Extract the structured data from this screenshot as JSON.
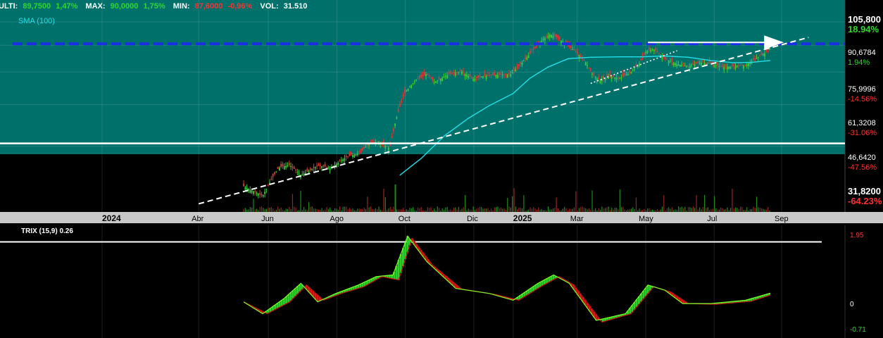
{
  "header": {
    "ulti_label": "ULTI:",
    "ulti_value": "89,7500",
    "ulti_pct": "1,47%",
    "max_label": "MAX:",
    "max_value": "90,0000",
    "max_pct": "1,75%",
    "min_label": "MIN:",
    "min_value": "87,6000",
    "min_pct": "-0,96%",
    "vol_label": "VOL:",
    "vol_value": "31.510"
  },
  "sma_label": "SMA (100)",
  "trix_label": "TRIX (15,9) 0.26",
  "colors": {
    "panel_bg": "#00706b",
    "up": "#3dcc3d",
    "down": "#e03838",
    "sma": "#21e0e8",
    "dash_blue": "#1b2ee8",
    "trix": "#7cff2a",
    "trix_signal": "#cc1010",
    "pos_text": "#2ed82e",
    "neg_text": "#ff3030"
  },
  "chart_data": [
    {
      "type": "candlestick",
      "title": "",
      "x_ticks": [
        "2024",
        "Abr",
        "Jun",
        "Ago",
        "Oct",
        "Dic",
        "2025",
        "Mar",
        "May",
        "Jul",
        "Sep"
      ],
      "y_ticks": [
        {
          "value": "105,800",
          "pct": "18.94%"
        },
        {
          "value": "90,6784",
          "pct": "1.94%"
        },
        {
          "value": "75,9996",
          "pct": "-14.56%"
        },
        {
          "value": "61,3208",
          "pct": "-31.06%"
        },
        {
          "value": "46,6420",
          "pct": "-47.56%"
        },
        {
          "value": "31,8200",
          "pct": "-64.23%"
        }
      ],
      "ylim": [
        31.82,
        105.8
      ],
      "price_path": [
        [
          "2024-05-15",
          35.8
        ],
        [
          "2024-06-01",
          33.6
        ],
        [
          "2024-06-15",
          40.5
        ],
        [
          "2024-06-25",
          41.2
        ],
        [
          "2024-07-05",
          38.5
        ],
        [
          "2024-07-20",
          41.0
        ],
        [
          "2024-08-01",
          40.5
        ],
        [
          "2024-08-15",
          43.5
        ],
        [
          "2024-08-25",
          44.5
        ],
        [
          "2024-09-05",
          47.5
        ],
        [
          "2024-09-12",
          48.2
        ],
        [
          "2024-09-22",
          46.0
        ],
        [
          "2024-09-28",
          56.0
        ],
        [
          "2024-10-05",
          66.0
        ],
        [
          "2024-10-15",
          72.0
        ],
        [
          "2024-10-25",
          75.0
        ],
        [
          "2024-11-01",
          71.0
        ],
        [
          "2024-11-12",
          74.5
        ],
        [
          "2024-11-25",
          76.5
        ],
        [
          "2024-12-05",
          72.5
        ],
        [
          "2024-12-15",
          74.0
        ],
        [
          "2024-12-25",
          74.5
        ],
        [
          "2025-01-08",
          75.0
        ],
        [
          "2025-01-15",
          79.0
        ],
        [
          "2025-01-25",
          85.5
        ],
        [
          "2025-02-05",
          94.0
        ],
        [
          "2025-02-12",
          97.5
        ],
        [
          "2025-02-20",
          94.5
        ],
        [
          "2025-03-01",
          90.0
        ],
        [
          "2025-03-08",
          86.0
        ],
        [
          "2025-03-15",
          81.5
        ],
        [
          "2025-03-22",
          74.5
        ],
        [
          "2025-03-28",
          72.0
        ],
        [
          "2025-04-05",
          74.0
        ],
        [
          "2025-04-15",
          73.0
        ],
        [
          "2025-04-25",
          76.0
        ],
        [
          "2025-05-02",
          80.0
        ],
        [
          "2025-05-08",
          87.0
        ],
        [
          "2025-05-15",
          88.5
        ],
        [
          "2025-05-25",
          83.0
        ],
        [
          "2025-06-05",
          80.0
        ],
        [
          "2025-06-15",
          79.0
        ],
        [
          "2025-06-25",
          81.0
        ],
        [
          "2025-07-05",
          80.5
        ],
        [
          "2025-07-15",
          78.5
        ],
        [
          "2025-07-25",
          79.0
        ],
        [
          "2025-08-05",
          79.5
        ],
        [
          "2025-08-15",
          83.5
        ],
        [
          "2025-08-22",
          86.0
        ],
        [
          "2025-08-27",
          89.75
        ]
      ],
      "sma": {
        "name": "SMA (100)",
        "points": [
          [
            "2024-10-01",
            38.5
          ],
          [
            "2024-10-20",
            43.0
          ],
          [
            "2024-11-10",
            50.0
          ],
          [
            "2024-12-01",
            56.0
          ],
          [
            "2024-12-20",
            61.0
          ],
          [
            "2025-01-10",
            66.0
          ],
          [
            "2025-01-25",
            73.0
          ],
          [
            "2025-02-10",
            78.5
          ],
          [
            "2025-02-28",
            83.0
          ],
          [
            "2025-03-20",
            83.8
          ],
          [
            "2025-04-15",
            84.0
          ],
          [
            "2025-05-05",
            84.0
          ],
          [
            "2025-05-25",
            84.5
          ],
          [
            "2025-06-15",
            83.8
          ],
          [
            "2025-07-05",
            82.0
          ],
          [
            "2025-07-25",
            80.8
          ],
          [
            "2025-08-10",
            81.0
          ],
          [
            "2025-08-27",
            82.0
          ]
        ]
      },
      "horizontal_lines": [
        {
          "style": "dashed-blue",
          "y": 91.5
        },
        {
          "style": "solid-white",
          "y": 47.5
        },
        {
          "style": "arrow-white",
          "y": 91.5,
          "x_from": "2025-05-10",
          "x_to": "2025-09-08"
        }
      ],
      "trendlines": [
        {
          "style": "dashed-white",
          "from": [
            "2024-04-05",
            31.9
          ],
          "to": [
            "2025-09-30",
            95.5
          ]
        },
        {
          "style": "dotted-white",
          "from": [
            "2025-03-20",
            70.5
          ],
          "to": [
            "2025-06-05",
            87.5
          ]
        }
      ]
    },
    {
      "type": "line",
      "title": "",
      "y_ticks": [
        "1.95",
        "0",
        "-0.71"
      ],
      "ylim": [
        -0.8,
        2.0
      ],
      "series": [
        {
          "name": "TRIX (15,9) 0.26",
          "points": [
            [
              "2024-05-15",
              0.0
            ],
            [
              "2024-06-01",
              -0.35
            ],
            [
              "2024-06-20",
              0.1
            ],
            [
              "2024-07-05",
              0.55
            ],
            [
              "2024-07-20",
              0.0
            ],
            [
              "2024-08-05",
              0.25
            ],
            [
              "2024-08-25",
              0.5
            ],
            [
              "2024-09-10",
              0.75
            ],
            [
              "2024-09-25",
              0.8
            ],
            [
              "2024-10-08",
              1.95
            ],
            [
              "2024-10-25",
              1.2
            ],
            [
              "2024-11-20",
              0.4
            ],
            [
              "2024-12-20",
              0.25
            ],
            [
              "2025-01-10",
              0.05
            ],
            [
              "2025-02-01",
              0.55
            ],
            [
              "2025-02-15",
              0.8
            ],
            [
              "2025-03-01",
              0.55
            ],
            [
              "2025-03-25",
              -0.55
            ],
            [
              "2025-04-20",
              -0.35
            ],
            [
              "2025-05-10",
              0.5
            ],
            [
              "2025-05-25",
              0.35
            ],
            [
              "2025-06-10",
              -0.05
            ],
            [
              "2025-07-05",
              -0.05
            ],
            [
              "2025-08-05",
              0.05
            ],
            [
              "2025-08-27",
              0.26
            ]
          ]
        },
        {
          "name": "",
          "points": [
            [
              "2024-05-15",
              0.0
            ],
            [
              "2024-06-05",
              -0.35
            ],
            [
              "2024-06-25",
              0.0
            ],
            [
              "2024-07-10",
              0.5
            ],
            [
              "2024-07-25",
              0.05
            ],
            [
              "2024-08-10",
              0.25
            ],
            [
              "2024-08-30",
              0.45
            ],
            [
              "2024-09-15",
              0.75
            ],
            [
              "2024-09-30",
              0.65
            ],
            [
              "2024-10-12",
              1.88
            ],
            [
              "2024-10-30",
              1.1
            ],
            [
              "2024-11-25",
              0.38
            ],
            [
              "2024-12-25",
              0.22
            ],
            [
              "2025-01-15",
              0.05
            ],
            [
              "2025-02-05",
              0.48
            ],
            [
              "2025-02-20",
              0.75
            ],
            [
              "2025-03-05",
              0.5
            ],
            [
              "2025-03-30",
              -0.6
            ],
            [
              "2025-04-25",
              -0.35
            ],
            [
              "2025-05-15",
              0.45
            ],
            [
              "2025-05-30",
              0.3
            ],
            [
              "2025-06-15",
              -0.05
            ],
            [
              "2025-07-10",
              -0.07
            ],
            [
              "2025-08-10",
              0.02
            ],
            [
              "2025-08-27",
              0.2
            ]
          ]
        }
      ],
      "hline": {
        "style": "solid-white",
        "y": 1.78
      }
    }
  ]
}
